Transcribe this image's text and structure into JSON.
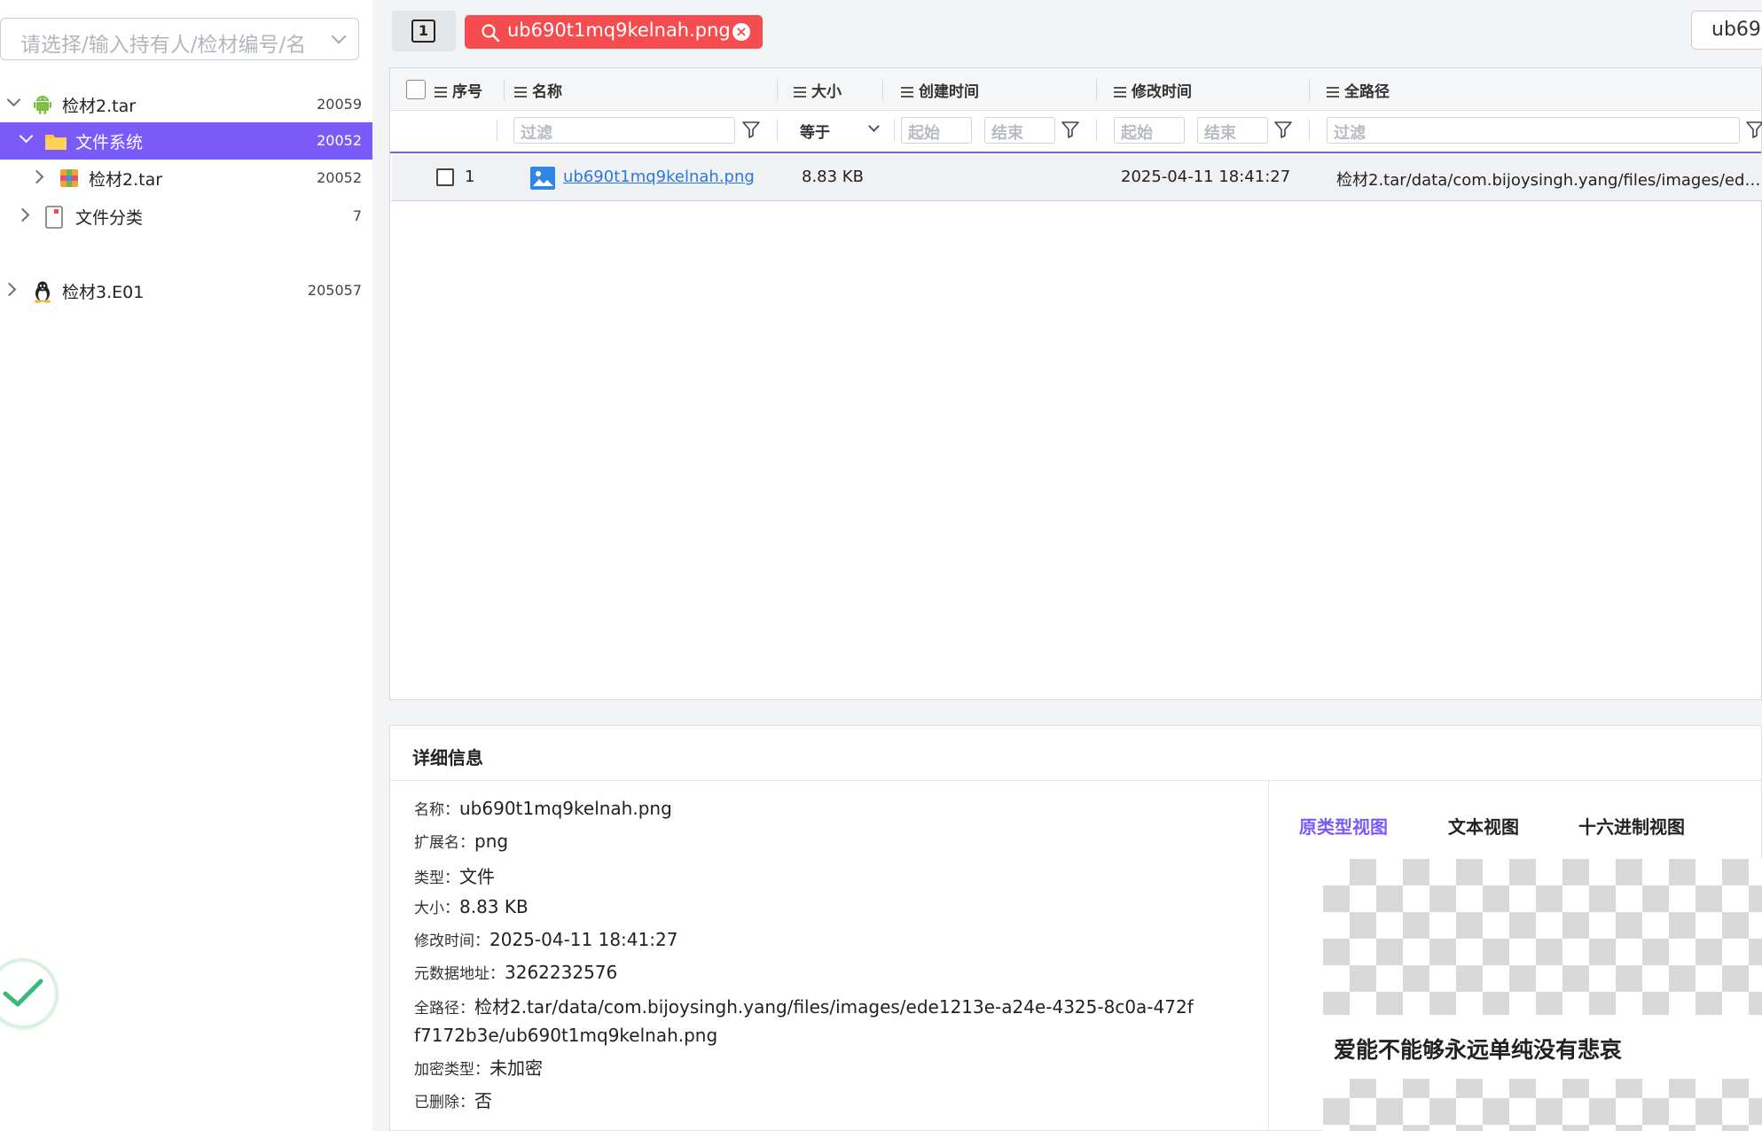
{
  "case_select": {
    "placeholder": "请选择/输入持有人/检材编号/名"
  },
  "tree": [
    {
      "label": "检材2.tar",
      "count": "20059"
    },
    {
      "label": "文件系统",
      "count": "20052"
    },
    {
      "label": "检材2.tar",
      "count": "20052"
    },
    {
      "label": "文件分类",
      "count": "7"
    },
    {
      "label": "检材3.E01",
      "count": "205057"
    }
  ],
  "topbar": {
    "tab_count": "1",
    "search_tag": "ub690t1mq9kelnah.png",
    "input_value": "ub69"
  },
  "table": {
    "columns": {
      "index": "序号",
      "name": "名称",
      "size": "大小",
      "created": "创建时间",
      "modified": "修改时间",
      "path": "全路径"
    },
    "filters": {
      "name_placeholder": "过滤",
      "size_op": "等于",
      "created_start": "起始",
      "created_end": "结束",
      "modified_start": "起始",
      "modified_end": "结束",
      "path_placeholder": "过滤"
    },
    "rows": [
      {
        "index": "1",
        "name": "ub690t1mq9kelnah.png",
        "size": "8.83 KB",
        "created": "",
        "modified": "2025-04-11 18:41:27",
        "path": "检材2.tar/data/com.bijoysingh.yang/files/images/ede1213e-a24e-4325-8c0a-472ff7172b3e/ub690t1mq9kelnah.png"
      }
    ]
  },
  "details": {
    "title": "详细信息",
    "fields": {
      "name_k": "名称：",
      "name_v": "ub690t1mq9kelnah.png",
      "ext_k": "扩展名：",
      "ext_v": "png",
      "type_k": "类型：",
      "type_v": "文件",
      "size_k": "大小：",
      "size_v": "8.83 KB",
      "mtime_k": "修改时间：",
      "mtime_v": "2025-04-11 18:41:27",
      "meta_k": "元数据地址：",
      "meta_v": "3262232576",
      "path_k": "全路径：",
      "path_v": "检材2.tar/data/com.bijoysingh.yang/files/images/ede1213e-a24e-4325-8c0a-472ff7172b3e/ub690t1mq9kelnah.png",
      "enc_k": "加密类型：",
      "enc_v": "未加密",
      "del_k": "已删除：",
      "del_v": "否"
    },
    "view_tabs": [
      "原类型视图",
      "文本视图",
      "十六进制视图"
    ],
    "preview_text": "爱能不能够永远单纯没有悲哀"
  },
  "colors": {
    "accent": "#7a5af8",
    "search_tag": "#f44c4f",
    "link": "#2b79e0",
    "ok": "#3cb878"
  }
}
